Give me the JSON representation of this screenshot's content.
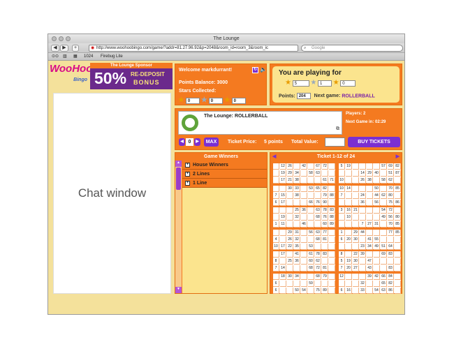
{
  "window": {
    "title": "The Lounge"
  },
  "browser": {
    "url": "http://www.woohoobingo.com/game/?addr=81.27.96.92&p=2048&room_id=room_3&room_ic",
    "search_placeholder": "Google",
    "bookmarks": [
      "1024",
      "Firebug Lite"
    ]
  },
  "logo": {
    "text": "WooHoo!!",
    "sub": "Bingo"
  },
  "banner": {
    "heading": "The Lounge Sponsor",
    "percent": "50%",
    "line1": "RE-DEPOSIT",
    "line2": "BONUS"
  },
  "chat": {
    "label": "Chat window"
  },
  "welcome": {
    "greeting": "Welcome markdurrant!",
    "points_balance": "Points Balance: 3000",
    "stars_label": "Stars Collected:",
    "stars": [
      "0",
      "0",
      "0"
    ]
  },
  "playing": {
    "heading": "You are playing for",
    "star_values": [
      "5",
      "1",
      "0"
    ],
    "points_label": "Points:",
    "points_value": "204",
    "next_game_label": "Next game:",
    "next_game_value": "ROLLERBALL"
  },
  "game": {
    "room_title": "The Lounge: ROLLERBALL",
    "players": "Players: 2",
    "next_game_in_label": "Next Game in:",
    "next_game_in_value": "02:29",
    "quantity": "0",
    "max_label": "MAX",
    "ticket_price_label": "Ticket Price:",
    "ticket_price_value": "5 points",
    "total_value_label": "Total Value:",
    "total_value": "",
    "buy_label": "BUY TICKETS"
  },
  "winners": {
    "title": "Game Winners",
    "items": [
      "House Winners",
      "2 Lines",
      "1 Line"
    ]
  },
  "tickets": {
    "title": "Ticket 1-12 of 24",
    "list": [
      [
        [
          "",
          "12",
          "26",
          "",
          "42",
          "",
          "67",
          "72",
          ""
        ],
        [
          "",
          "19",
          "29",
          "34",
          "",
          "58",
          "63",
          "",
          ""
        ],
        [
          "",
          "17",
          "21",
          "38",
          "",
          "",
          "",
          "61",
          "71"
        ]
      ],
      [
        [
          "5",
          "19",
          "",
          "",
          "",
          "",
          "57",
          "69",
          "82"
        ],
        [
          "",
          "",
          "",
          "14",
          "29",
          "40",
          "",
          "51",
          "87"
        ],
        [
          "10",
          "",
          "",
          "26",
          "38",
          "",
          "58",
          "62",
          ""
        ]
      ],
      [
        [
          "",
          "",
          "30",
          "33",
          "",
          "53",
          "65",
          "82",
          ""
        ],
        [
          "7",
          "15",
          "",
          "38",
          "",
          "",
          "",
          "79",
          "88"
        ],
        [
          "6",
          "17",
          "",
          "",
          "",
          "66",
          "76",
          "90",
          ""
        ]
      ],
      [
        [
          "10",
          "14",
          "",
          "",
          "",
          "50",
          "",
          "70",
          "85"
        ],
        [
          "7",
          "",
          "",
          "24",
          "",
          "44",
          "62",
          "80",
          ""
        ],
        [
          "",
          "",
          "",
          "36",
          "",
          "56",
          "",
          "75",
          "86"
        ]
      ],
      [
        [
          "",
          "",
          "",
          "25",
          "36",
          "",
          "63",
          "78",
          "83"
        ],
        [
          "",
          "19",
          "",
          "32",
          "",
          "",
          "68",
          "76",
          "88"
        ],
        [
          "1",
          "11",
          "",
          "",
          "46",
          "",
          "",
          "60",
          "89"
        ]
      ],
      [
        [
          "3",
          "16",
          "21",
          "",
          "",
          "",
          "54",
          "72",
          ""
        ],
        [
          "",
          "10",
          "",
          "",
          "",
          "",
          "49",
          "56",
          "80"
        ],
        [
          "",
          "",
          "",
          "7",
          "27",
          "31",
          "",
          "70",
          "85"
        ]
      ],
      [
        [
          "",
          "",
          "29",
          "31",
          "",
          "56",
          "63",
          "77",
          ""
        ],
        [
          "4",
          "",
          "26",
          "32",
          "",
          "",
          "68",
          "81",
          ""
        ],
        [
          "10",
          "17",
          "22",
          "35",
          "",
          "53",
          "",
          ""
        ]
      ],
      [
        [
          "1",
          "",
          "29",
          "44",
          "",
          "",
          "",
          "77",
          "85"
        ],
        [
          "6",
          "20",
          "30",
          "",
          "41",
          "55",
          "",
          ""
        ],
        [
          "",
          "",
          "",
          "23",
          "34",
          "49",
          "51",
          "64",
          ""
        ]
      ],
      [
        [
          "",
          "17",
          "",
          "41",
          "",
          "61",
          "78",
          "83",
          ""
        ],
        [
          "8",
          "",
          "25",
          "36",
          "",
          "60",
          "62",
          "",
          ""
        ],
        [
          "7",
          "14",
          "",
          "",
          "",
          "68",
          "72",
          "81",
          ""
        ]
      ],
      [
        [
          "8",
          "",
          "22",
          "39",
          "",
          "",
          "69",
          "83",
          ""
        ],
        [
          "5",
          "19",
          "30",
          "",
          "47",
          "",
          ""
        ],
        [
          "7",
          "20",
          "27",
          "",
          "43",
          "",
          "",
          "83",
          ""
        ]
      ],
      [
        [
          "",
          "18",
          "30",
          "34",
          "",
          "",
          "68",
          "79",
          ""
        ],
        [
          "6",
          "",
          "",
          "",
          "",
          "59",
          "",
          "",
          ""
        ],
        [
          "6",
          "",
          "",
          "50",
          "54",
          "",
          "75",
          "89",
          ""
        ]
      ],
      [
        [
          "12",
          "",
          "",
          "",
          "39",
          "42",
          "66",
          "84",
          ""
        ],
        [
          "",
          "",
          "",
          "32",
          "",
          "",
          "65",
          "82",
          ""
        ],
        [
          "6",
          "16",
          "",
          "33",
          "",
          "54",
          "63",
          "86",
          ""
        ]
      ]
    ]
  }
}
